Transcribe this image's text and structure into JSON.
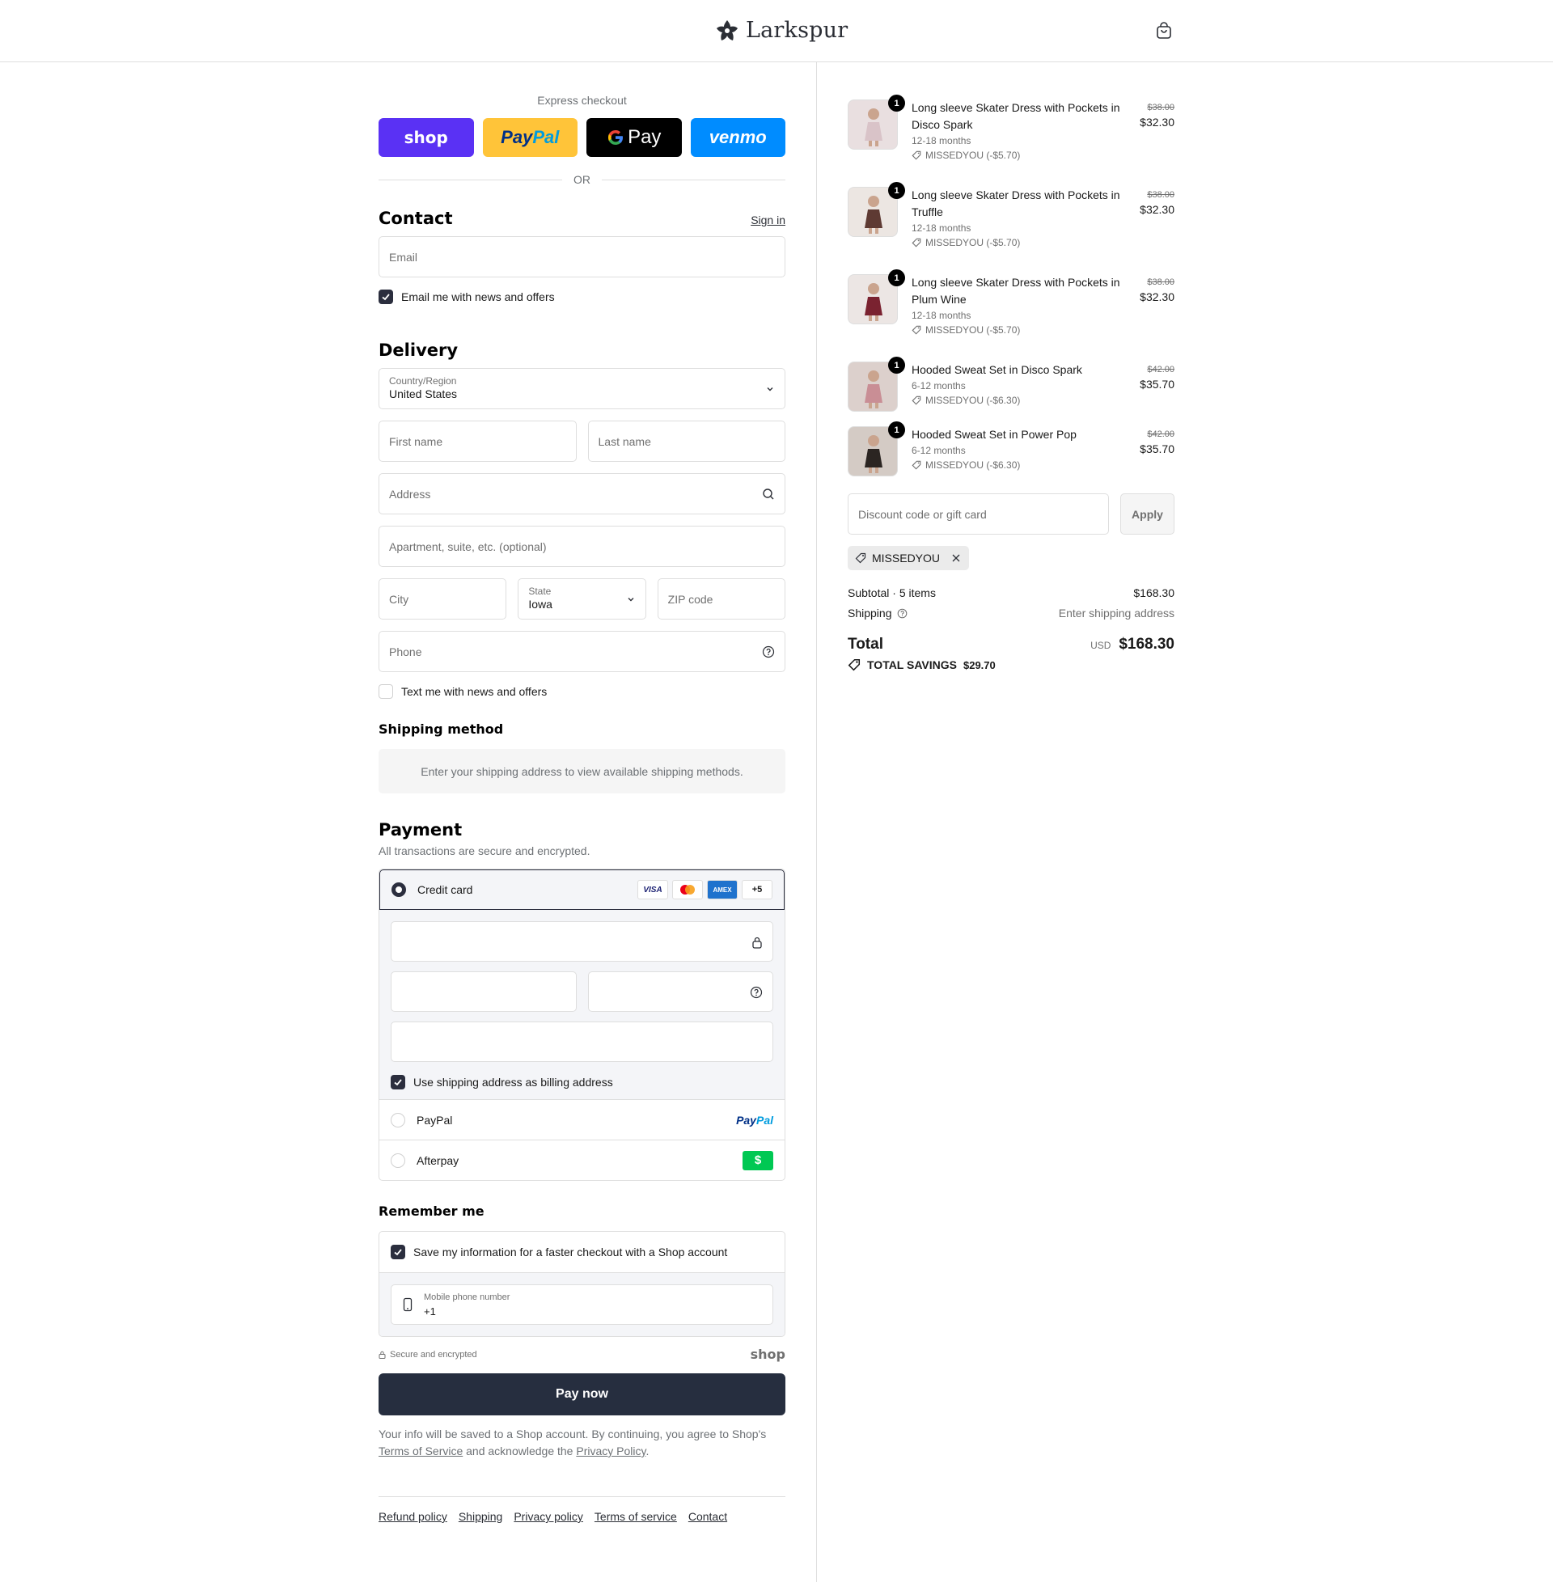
{
  "header": {
    "brand": "Larkspur"
  },
  "express": {
    "title": "Express checkout",
    "shop": "shop",
    "paypal_a": "Pay",
    "paypal_b": "Pal",
    "gpay": "Pay",
    "venmo": "venmo",
    "or": "OR"
  },
  "contact": {
    "title": "Contact",
    "sign_in": "Sign in",
    "email_placeholder": "Email",
    "news_label": "Email me with news and offers"
  },
  "delivery": {
    "title": "Delivery",
    "country_label": "Country/Region",
    "country_value": "United States",
    "first_name": "First name",
    "last_name": "Last name",
    "address": "Address",
    "apartment": "Apartment, suite, etc. (optional)",
    "city": "City",
    "state_label": "State",
    "state_value": "Iowa",
    "zip": "ZIP code",
    "phone": "Phone",
    "text_label": "Text me with news and offers"
  },
  "shipping_method": {
    "title": "Shipping method",
    "note": "Enter your shipping address to view available shipping methods."
  },
  "payment": {
    "title": "Payment",
    "subtitle": "All transactions are secure and encrypted.",
    "credit_card": "Credit card",
    "cards": [
      "VISA",
      "AMEX",
      "+5"
    ],
    "billing_label": "Use shipping address as billing address",
    "paypal": "PayPal",
    "paypal_logo_a": "Pay",
    "paypal_logo_b": "Pal",
    "afterpay": "Afterpay",
    "afterpay_logo": "$"
  },
  "remember": {
    "title": "Remember me",
    "save_label": "Save my information for a faster checkout with a Shop account",
    "phone_label": "Mobile phone number",
    "phone_value": "+1",
    "secure": "Secure and encrypted",
    "shop_logo": "shop"
  },
  "pay_now": "Pay now",
  "fine_print": {
    "a": "Your info will be saved to a Shop account. By continuing, you agree to Shop's",
    "tos": "Terms of Service",
    "b": "and acknowledge the",
    "privacy": "Privacy Policy",
    "c": "."
  },
  "footer": [
    "Refund policy",
    "Shipping",
    "Privacy policy",
    "Terms of service",
    "Contact"
  ],
  "items": [
    {
      "qty": "1",
      "name": "Long sleeve Skater Dress with Pockets in Disco Spark",
      "variant": "12-18 months",
      "discount": "MISSEDYOU (-$5.70)",
      "old": "$38.00",
      "price": "$32.30",
      "color": "#e9dfe0",
      "dress": "#d9c3c8"
    },
    {
      "qty": "1",
      "name": "Long sleeve Skater Dress with Pockets in Truffle",
      "variant": "12-18 months",
      "discount": "MISSEDYOU (-$5.70)",
      "old": "$38.00",
      "price": "$32.30",
      "color": "#ece6e2",
      "dress": "#5e3a33"
    },
    {
      "qty": "1",
      "name": "Long sleeve Skater Dress with Pockets in Plum Wine",
      "variant": "12-18 months",
      "discount": "MISSEDYOU (-$5.70)",
      "old": "$38.00",
      "price": "$32.30",
      "color": "#ece6e4",
      "dress": "#7a2230"
    },
    {
      "qty": "1",
      "name": "Hooded Sweat Set in Disco Spark",
      "variant": "6-12 months",
      "discount": "MISSEDYOU (-$6.30)",
      "old": "$42.00",
      "price": "$35.70",
      "color": "#dcd0cc",
      "dress": "#c98e95"
    },
    {
      "qty": "1",
      "name": "Hooded Sweat Set in Power Pop",
      "variant": "6-12 months",
      "discount": "MISSEDYOU (-$6.30)",
      "old": "$42.00",
      "price": "$35.70",
      "color": "#d4cbc5",
      "dress": "#2b2522"
    }
  ],
  "discount": {
    "placeholder": "Discount code or gift card",
    "apply": "Apply",
    "applied_code": "MISSEDYOU"
  },
  "summary": {
    "subtotal_label": "Subtotal · 5 items",
    "subtotal": "$168.30",
    "shipping_label": "Shipping",
    "shipping_value": "Enter shipping address",
    "total_label": "Total",
    "currency": "USD",
    "total": "$168.30",
    "savings_label": "TOTAL SAVINGS",
    "savings": "$29.70"
  },
  "colors": {
    "accent": "#262e3f",
    "shop": "#5a31f4",
    "paypal": "#ffc439",
    "venmo": "#008cff",
    "afterpay": "#00c853"
  }
}
